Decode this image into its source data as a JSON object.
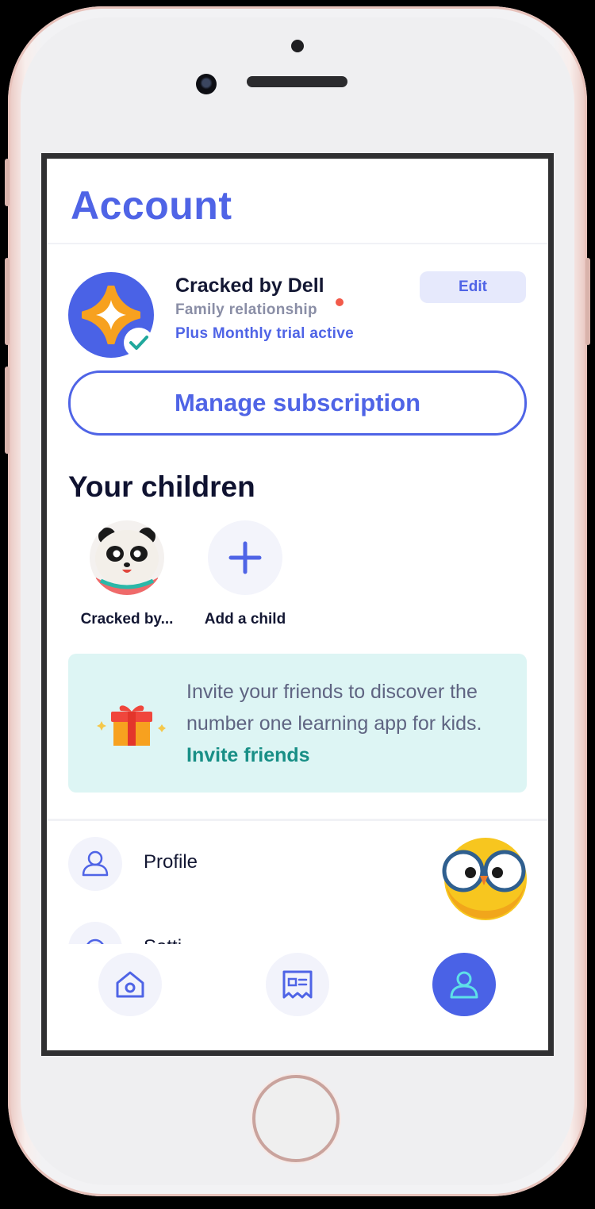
{
  "header": {
    "title": "Account"
  },
  "account": {
    "name": "Cracked by Dell",
    "relationship": "Family relationship",
    "subscription_status": "Plus Monthly trial active",
    "edit_label": "Edit",
    "manage_label": "Manage subscription"
  },
  "children": {
    "title": "Your children",
    "items": [
      {
        "label": "Cracked by...",
        "avatar": "panda-avatar"
      },
      {
        "label": "Add a child",
        "icon": "plus-icon"
      }
    ]
  },
  "invite": {
    "text": "Invite your friends to discover the number one learning app for kids. ",
    "link": "Invite friends",
    "icon": "gift-icon"
  },
  "menu": {
    "items": [
      {
        "label": "Profile",
        "icon": "user-icon"
      },
      {
        "label": "Setti",
        "icon": "gear-icon"
      }
    ]
  },
  "tabbar": {
    "items": [
      {
        "name": "home",
        "icon": "home-icon",
        "active": false
      },
      {
        "name": "tickets",
        "icon": "ticket-icon",
        "active": false
      },
      {
        "name": "account",
        "icon": "user-icon",
        "active": true
      }
    ]
  },
  "colors": {
    "accent": "#4f64e6",
    "invite_bg": "#ddf5f4",
    "invite_link": "#188f86",
    "dot": "#f25a4a"
  }
}
